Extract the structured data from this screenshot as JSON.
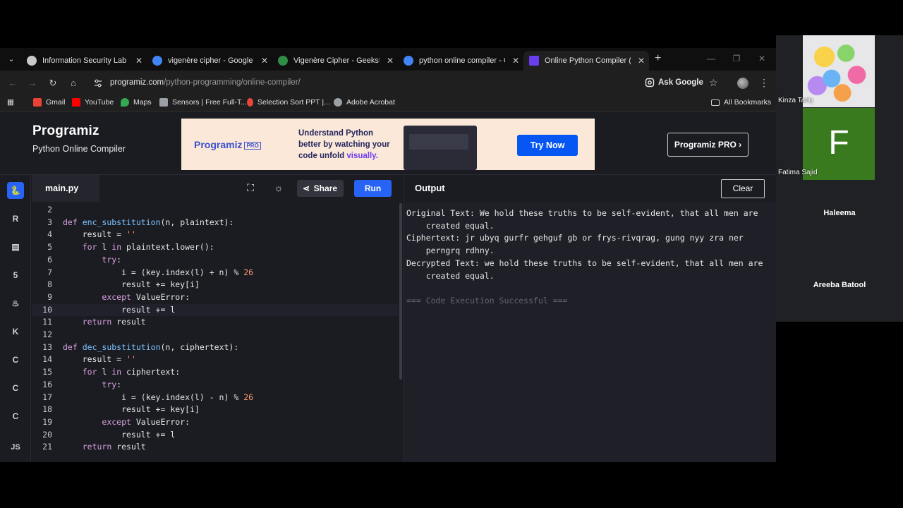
{
  "browser": {
    "tabs": [
      {
        "label": "Information Security Lab Too",
        "active": false,
        "favicon_color": "#c9c9c9"
      },
      {
        "label": "vigenère cipher - Google Sea",
        "active": false,
        "favicon_color": "#4285f4"
      },
      {
        "label": "Vigenère Cipher - GeeksforGe",
        "active": false,
        "favicon_color": "#2f8d46"
      },
      {
        "label": "python online compiler - Go",
        "active": false,
        "favicon_color": "#4285f4"
      },
      {
        "label": "Online Python Compiler (Inte",
        "active": true,
        "favicon_color": "#6b3df0"
      }
    ],
    "new_tab": "+",
    "address": {
      "host": "programiz.com",
      "path": "/python-programming/online-compiler/"
    },
    "ask_google": "Ask Google",
    "bookmarks": [
      {
        "label": "Gmail",
        "color": "#ea4335"
      },
      {
        "label": "YouTube",
        "color": "#ff0000"
      },
      {
        "label": "Maps",
        "color": "#34a853"
      },
      {
        "label": "Sensors | Free Full-T...",
        "color": "#9aa0a6"
      },
      {
        "label": "Selection Sort PPT |...",
        "color": "#e8453c"
      },
      {
        "label": "Adobe Acrobat",
        "color": "#9aa0a6"
      }
    ],
    "all_bookmarks": "All Bookmarks"
  },
  "site": {
    "logo": "Programiz",
    "subtitle": "Python Online Compiler",
    "banner": {
      "logo": "Programiz",
      "logo_badge": "PRO",
      "text_a": "Understand Python",
      "text_b": "better by watching your",
      "text_c": "code unfold ",
      "text_highlight": "visually.",
      "cta": "Try Now"
    },
    "pro_button": "Programiz PRO ›"
  },
  "sidebar_languages": [
    "python-icon",
    "r-icon",
    "sql-icon",
    "html-icon",
    "java-icon",
    "kotlin-icon",
    "c-icon",
    "cpp-icon",
    "csharp-icon",
    "js-icon"
  ],
  "sidebar_js_label": "JS",
  "editor": {
    "file_name": "main.py",
    "share": "Share",
    "run": "Run",
    "lines": [
      {
        "n": "2",
        "code": ""
      },
      {
        "n": "3",
        "code": "def enc_substitution(n, plaintext):"
      },
      {
        "n": "4",
        "code": "    result = ''"
      },
      {
        "n": "5",
        "code": "    for l in plaintext.lower():"
      },
      {
        "n": "6",
        "code": "        try:"
      },
      {
        "n": "7",
        "code": "            i = (key.index(l) + n) % 26"
      },
      {
        "n": "8",
        "code": "            result += key[i]"
      },
      {
        "n": "9",
        "code": "        except ValueError:"
      },
      {
        "n": "10",
        "code": "            result += l"
      },
      {
        "n": "11",
        "code": "    return result"
      },
      {
        "n": "12",
        "code": ""
      },
      {
        "n": "13",
        "code": "def dec_substitution(n, ciphertext):"
      },
      {
        "n": "14",
        "code": "    result = ''"
      },
      {
        "n": "15",
        "code": "    for l in ciphertext:"
      },
      {
        "n": "16",
        "code": "        try:"
      },
      {
        "n": "17",
        "code": "            i = (key.index(l) - n) % 26"
      },
      {
        "n": "18",
        "code": "            result += key[i]"
      },
      {
        "n": "19",
        "code": "        except ValueError:"
      },
      {
        "n": "20",
        "code": "            result += l"
      },
      {
        "n": "21",
        "code": "    return result"
      }
    ],
    "current_line": "10"
  },
  "output": {
    "title": "Output",
    "clear": "Clear",
    "lines": [
      "Original Text: We hold these truths to be self-evident, that all men are",
      "    created equal.",
      "Ciphertext: jr ubyq gurfr gehguf gb or frys-rivqrag, gung nyy zra ner",
      "    perngrq rdhny.",
      "Decrypted Text: we hold these truths to be self-evident, that all men are",
      "    created equal.",
      "",
      "=== Code Execution Successful ==="
    ]
  },
  "meeting": {
    "participants": [
      {
        "name": "Kinza Tariq"
      },
      {
        "name": "Fatima Sajid",
        "initial": "F",
        "color": "#3a7a1f"
      },
      {
        "name": "Haleema"
      },
      {
        "name": "Areeba Batool"
      }
    ]
  }
}
